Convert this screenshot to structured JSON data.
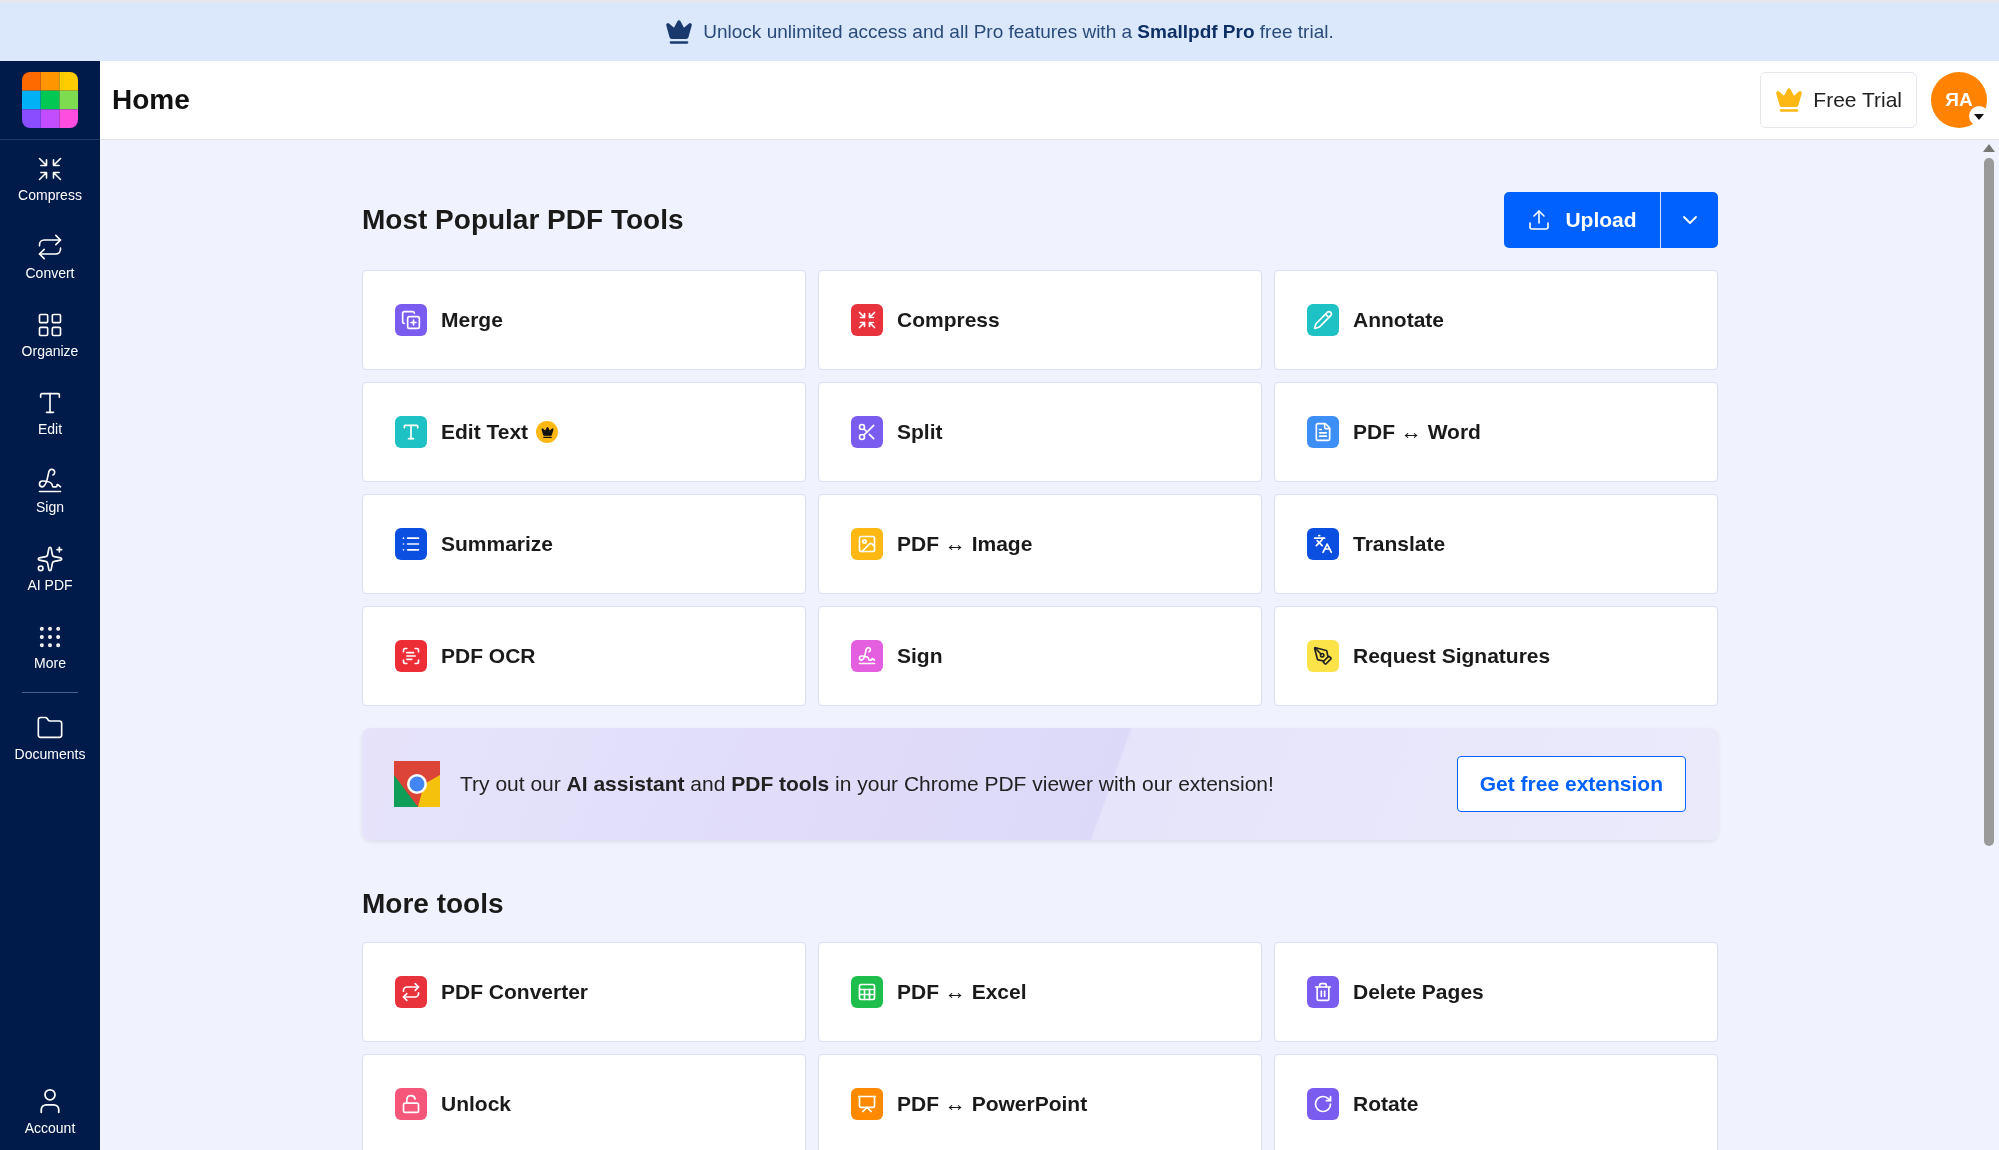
{
  "promo_banner": {
    "text": "Unlock unlimited access and all Pro features with a **Smallpdf Pro** free trial."
  },
  "sidebar": {
    "items": [
      {
        "label": "Compress"
      },
      {
        "label": "Convert"
      },
      {
        "label": "Organize"
      },
      {
        "label": "Edit"
      },
      {
        "label": "Sign"
      },
      {
        "label": "AI PDF"
      },
      {
        "label": "More"
      },
      {
        "label": "Documents"
      }
    ],
    "account": {
      "label": "Account"
    }
  },
  "header": {
    "title": "Home",
    "trial_button": "Free Trial",
    "avatar": "ЯA"
  },
  "popular": {
    "title": "Most Popular PDF Tools",
    "upload_button": "Upload",
    "tools": [
      {
        "label": "Merge",
        "color": "#7b5cf0",
        "pro": false
      },
      {
        "label": "Compress",
        "color": "#e8323c",
        "pro": false
      },
      {
        "label": "Annotate",
        "color": "#1fc2c4",
        "pro": false
      },
      {
        "label": "Edit Text",
        "color": "#1fc2c4",
        "pro": true
      },
      {
        "label": "Split",
        "color": "#7b5cf0",
        "pro": false
      },
      {
        "label": "PDF ↔ Word",
        "color": "#3d8ef5",
        "pro": false
      },
      {
        "label": "Summarize",
        "color": "#0b4fe0",
        "pro": false
      },
      {
        "label": "PDF ↔ Image",
        "color": "#fdb813",
        "pro": false
      },
      {
        "label": "Translate",
        "color": "#0b4fe0",
        "pro": false
      },
      {
        "label": "PDF OCR",
        "color": "#ee2e36",
        "pro": false
      },
      {
        "label": "Sign",
        "color": "#e45ee0",
        "pro": false
      },
      {
        "label": "Request Signatures",
        "color": "#fde34a",
        "pro": false
      }
    ]
  },
  "extension_banner": {
    "text": "Try out our **AI assistant** and **PDF tools** in your Chrome PDF viewer with our extension!",
    "button": "Get free extension"
  },
  "more_tools": {
    "title": "More tools",
    "tools": [
      {
        "label": "PDF Converter",
        "color": "#e8323c",
        "pro": false
      },
      {
        "label": "PDF ↔ Excel",
        "color": "#1dbe4b",
        "pro": false
      },
      {
        "label": "Delete Pages",
        "color": "#7b5cf0",
        "pro": false
      },
      {
        "label": "Unlock",
        "color": "#f5577a",
        "pro": false
      },
      {
        "label": "PDF ↔ PowerPoint",
        "color": "#ff8a00",
        "pro": false
      },
      {
        "label": "Rotate",
        "color": "#7b5cf0",
        "pro": false
      }
    ]
  }
}
